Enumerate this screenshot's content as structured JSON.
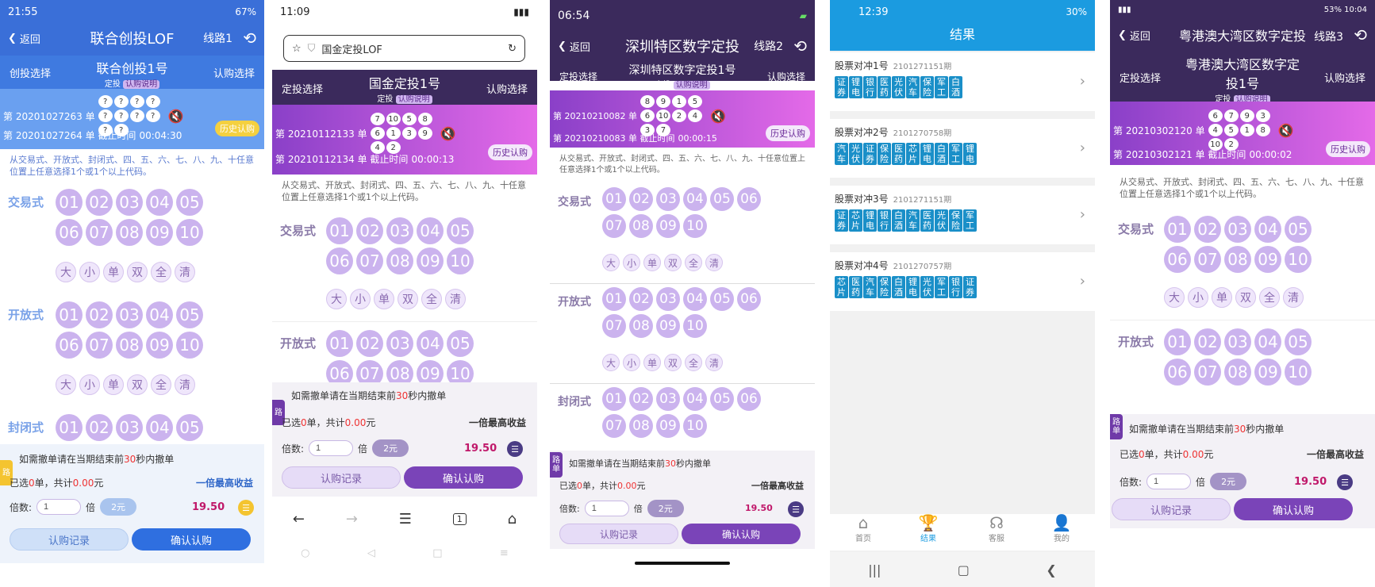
{
  "p1": {
    "status": {
      "time": "21:55",
      "battery": "67%"
    },
    "nav": {
      "back": "返回",
      "title": "联合创投LOF",
      "line": "线路1"
    },
    "header": {
      "left": "创投选择",
      "title": "联合创投1号",
      "sub1": "定投",
      "sub2": "认购说明",
      "right": "认购选择"
    },
    "result": {
      "row1": "第 20201027263 单",
      "row1_balls": [
        "?",
        "?",
        "?",
        "?",
        "?",
        "?",
        "?",
        "?",
        "?",
        "?"
      ],
      "row2": "第 20201027264 单 截止时间",
      "row2_time": "00:04:30",
      "hist": "历史认购"
    },
    "desc": "从交易式、开放式、封闭式、四、五、六、七、八、九、十任意位置上任意选择1个或1个以上代码。",
    "sections": [
      "交易式",
      "开放式",
      "封闭式"
    ],
    "balls": [
      "01",
      "02",
      "03",
      "04",
      "05",
      "06",
      "07",
      "08",
      "09",
      "10"
    ],
    "opts": [
      "大",
      "小",
      "单",
      "双",
      "全",
      "清"
    ],
    "bottom": {
      "warn_a": "如需撤单请在当期结束前",
      "warn_b": "30",
      "warn_c": "秒内撤单",
      "sel_a": "已选",
      "sel_b": "0",
      "sel_c": "单，共计",
      "sel_d": "0.00",
      "sel_e": "元",
      "best": "一倍最高收益",
      "mult_a": "倍数:",
      "mult_v": "1",
      "mult_b": "倍",
      "price": "2元",
      "money": "19.50",
      "calc": "☰",
      "btn_record": "认购记录",
      "btn_confirm": "确认认购",
      "route": "路"
    }
  },
  "p2": {
    "status": {
      "time": "11:09"
    },
    "url": "国金定投LOF",
    "header": {
      "left": "定投选择",
      "title": "国金定投1号",
      "sub1": "定投",
      "sub2": "认购说明",
      "right": "认购选择"
    },
    "result": {
      "row1": "第 20210112133 单",
      "row1_balls": [
        "7",
        "10",
        "5",
        "8",
        "6",
        "1",
        "3",
        "9",
        "4",
        "2"
      ],
      "row2": "第 20210112134 单 截止时间",
      "row2_time": "00:00:13",
      "hist": "历史认购"
    },
    "desc": "从交易式、开放式、封闭式、四、五、六、七、八、九、十任意位置上任意选择1个或1个以上代码。",
    "sections": [
      "交易式",
      "开放式"
    ],
    "balls": [
      "01",
      "02",
      "03",
      "04",
      "05",
      "06",
      "07",
      "08",
      "09",
      "10"
    ],
    "opts": [
      "大",
      "小",
      "单",
      "双",
      "全",
      "清"
    ],
    "bottom": {
      "warn_a": "如需撤单请在当期结束前",
      "warn_b": "30",
      "warn_c": "秒内撤单",
      "sel_a": "已选",
      "sel_b": "0",
      "sel_c": "单，共计",
      "sel_d": "0.00",
      "sel_e": "元",
      "best": "一倍最高收益",
      "mult_a": "倍数:",
      "mult_v": "1",
      "mult_b": "倍",
      "price": "2元",
      "money": "19.50",
      "calc": "☰",
      "btn_record": "认购记录",
      "btn_confirm": "确认认购",
      "route": "路"
    },
    "browser": {
      "back": "←",
      "fwd": "→",
      "menu": "☰",
      "tabs": "1",
      "home": "⌂"
    }
  },
  "p3": {
    "status": {
      "time": "06:54"
    },
    "nav": {
      "back": "返回",
      "title": "深圳特区数字定投",
      "line": "线路2"
    },
    "header": {
      "left": "定投选择",
      "title": "深圳特区数字定投1号",
      "sub1": "定投",
      "sub2": "认购说明",
      "right": "认购选择"
    },
    "result": {
      "row1": "第 20210210082 单",
      "row1_balls": [
        "8",
        "9",
        "1",
        "5",
        "6",
        "10",
        "2",
        "4",
        "3",
        "7"
      ],
      "row2": "第 20210210083 单 截止时间",
      "row2_time": "00:00:15",
      "hist": "历史认购"
    },
    "desc": "从交易式、开放式、封闭式、四、五、六、七、八、九、十任意位置上任意选择1个或1个以上代码。",
    "sections": [
      "交易式",
      "开放式",
      "封闭式"
    ],
    "balls": [
      "01",
      "02",
      "03",
      "04",
      "05",
      "06",
      "07",
      "08",
      "09",
      "10"
    ],
    "opts": [
      "大",
      "小",
      "单",
      "双",
      "全",
      "清"
    ],
    "bottom": {
      "warn_a": "如需撤单请在当期结束前",
      "warn_b": "30",
      "warn_c": "秒内撤单",
      "sel_a": "已选",
      "sel_b": "0",
      "sel_c": "单，共计",
      "sel_d": "0.00",
      "sel_e": "元",
      "best": "一倍最高收益",
      "mult_a": "倍数:",
      "mult_v": "1",
      "mult_b": "倍",
      "price": "2元",
      "money": "19.50",
      "calc": "☰",
      "btn_record": "认购记录",
      "btn_confirm": "确认认购",
      "route": "路单"
    }
  },
  "p4": {
    "status": {
      "time": "12:39",
      "battery": "30%"
    },
    "title": "结果",
    "items": [
      {
        "name": "股票对冲1号",
        "period": "2101271151期",
        "chips": [
          "证券",
          "锂电",
          "银行",
          "医药",
          "光伏",
          "汽车",
          "保险",
          "军工",
          "白酒"
        ]
      },
      {
        "name": "股票对冲2号",
        "period": "2101270758期",
        "chips": [
          "汽车",
          "光伏",
          "证券",
          "保险",
          "医药",
          "芯片",
          "锂电",
          "白酒",
          "军工",
          "锂电"
        ]
      },
      {
        "name": "股票对冲3号",
        "period": "2101271151期",
        "chips": [
          "证券",
          "芯片",
          "锂电",
          "银行",
          "白酒",
          "汽车",
          "医药",
          "光伏",
          "保险",
          "军工"
        ]
      },
      {
        "name": "股票对冲4号",
        "period": "2101270757期",
        "chips": [
          "芯片",
          "医药",
          "汽车",
          "保险",
          "白酒",
          "锂电",
          "光伏",
          "军工",
          "银行",
          "证券"
        ]
      }
    ],
    "tabs": [
      "首页",
      "结果",
      "客服",
      "我的"
    ]
  },
  "p5": {
    "status": {
      "time": "10:04",
      "battery": "53%"
    },
    "nav": {
      "back": "返回",
      "title": "粤港澳大湾区数字定投",
      "line": "线路3"
    },
    "header": {
      "left": "定投选择",
      "title": "粤港澳大湾区数字定",
      "title2": "投1号",
      "sub1": "定投",
      "sub2": "认购说明",
      "right": "认购选择"
    },
    "result": {
      "row1": "第 20210302120 单",
      "row1_balls": [
        "6",
        "7",
        "9",
        "3",
        "4",
        "5",
        "1",
        "8",
        "10",
        "2"
      ],
      "row2": "第 20210302121 单 截止时间",
      "row2_time": "00:00:02",
      "hist": "历史认购"
    },
    "desc": "从交易式、开放式、封闭式、四、五、六、七、八、九、十任意位置上任意选择1个或1个以上代码。",
    "sections": [
      "交易式",
      "开放式"
    ],
    "balls": [
      "01",
      "02",
      "03",
      "04",
      "05",
      "06",
      "07",
      "08",
      "09",
      "10"
    ],
    "opts": [
      "大",
      "小",
      "单",
      "双",
      "全",
      "清"
    ],
    "bottom": {
      "warn_a": "如需撤单请在当期结束前",
      "warn_b": "30",
      "warn_c": "秒内撤单",
      "sel_a": "已选",
      "sel_b": "0",
      "sel_c": "单，共计",
      "sel_d": "0.00",
      "sel_e": "元",
      "best": "一倍最高收益",
      "mult_a": "倍数:",
      "mult_v": "1",
      "mult_b": "倍",
      "price": "2元",
      "money": "19.50",
      "calc": "☰",
      "btn_record": "认购记录",
      "btn_confirm": "确认认购",
      "route": "路单"
    }
  }
}
